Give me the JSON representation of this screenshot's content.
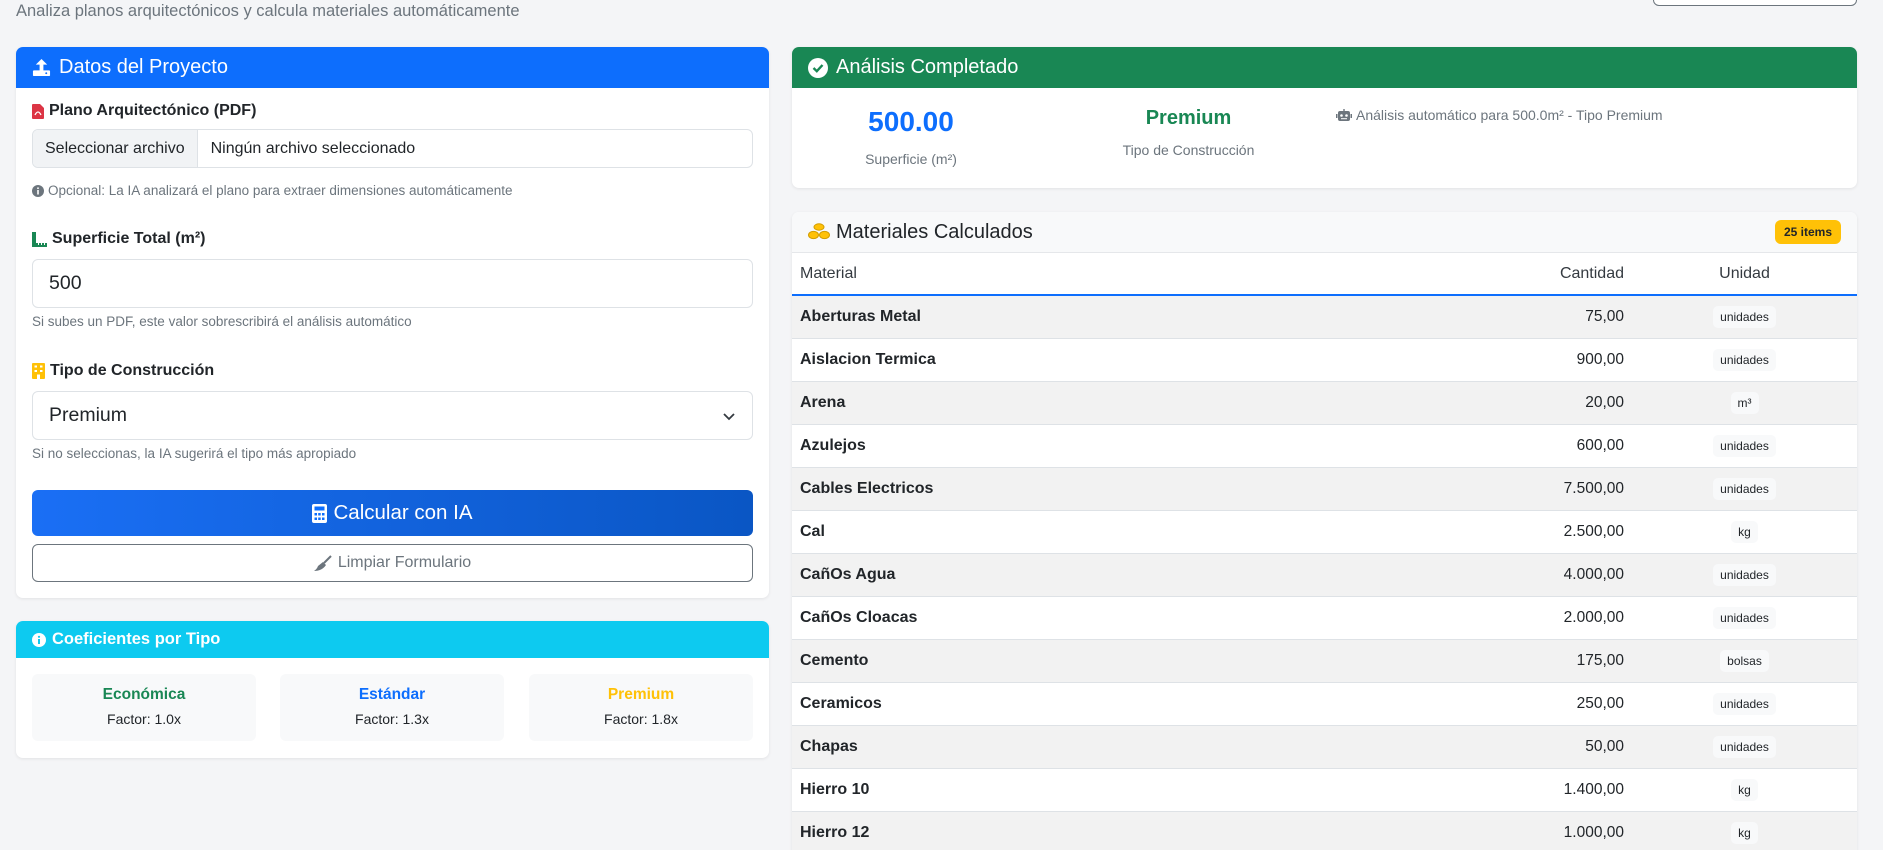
{
  "header": {
    "subtitle": "Analiza planos arquitectónicos y calcula materiales automáticamente"
  },
  "form": {
    "title": "Datos del Proyecto",
    "pdf_label": "Plano Arquitectónico (PDF)",
    "file_button": "Seleccionar archivo",
    "file_status": "Ningún archivo seleccionado",
    "pdf_help": "Opcional: La IA analizará el plano para extraer dimensiones automáticamente",
    "area_label": "Superficie Total (m²)",
    "area_value": "500",
    "area_help": "Si subes un PDF, este valor sobrescribirá el análisis automático",
    "type_label": "Tipo de Construcción",
    "type_value": "Premium",
    "type_help": "Si no seleccionas, la IA sugerirá el tipo más apropiado",
    "calc_button": "Calcular con IA",
    "clear_button": "Limpiar Formulario"
  },
  "coefficients": {
    "title": "Coeficientes por Tipo",
    "items": [
      {
        "name": "Económica",
        "factor": "Factor: 1.0x",
        "color": "#198754"
      },
      {
        "name": "Estándar",
        "factor": "Factor: 1.3x",
        "color": "#0d6efd"
      },
      {
        "name": "Premium",
        "factor": "Factor: 1.8x",
        "color": "#ffc107"
      }
    ]
  },
  "analysis": {
    "title": "Análisis Completado",
    "surface_value": "500.00",
    "surface_label": "Superficie (m²)",
    "type_value": "Premium",
    "type_label": "Tipo de Construcción",
    "note": "Análisis automático para 500.0m² - Tipo Premium"
  },
  "materials": {
    "title": "Materiales Calculados",
    "badge": "25 items",
    "columns": [
      "Material",
      "Cantidad",
      "Unidad"
    ],
    "rows": [
      {
        "material": "Aberturas Metal",
        "cantidad": "75,00",
        "unidad": "unidades"
      },
      {
        "material": "Aislacion Termica",
        "cantidad": "900,00",
        "unidad": "unidades"
      },
      {
        "material": "Arena",
        "cantidad": "20,00",
        "unidad": "m³"
      },
      {
        "material": "Azulejos",
        "cantidad": "600,00",
        "unidad": "unidades"
      },
      {
        "material": "Cables Electricos",
        "cantidad": "7.500,00",
        "unidad": "unidades"
      },
      {
        "material": "Cal",
        "cantidad": "2.500,00",
        "unidad": "kg"
      },
      {
        "material": "CañOs Agua",
        "cantidad": "4.000,00",
        "unidad": "unidades"
      },
      {
        "material": "CañOs Cloacas",
        "cantidad": "2.000,00",
        "unidad": "unidades"
      },
      {
        "material": "Cemento",
        "cantidad": "175,00",
        "unidad": "bolsas"
      },
      {
        "material": "Ceramicos",
        "cantidad": "250,00",
        "unidad": "unidades"
      },
      {
        "material": "Chapas",
        "cantidad": "50,00",
        "unidad": "unidades"
      },
      {
        "material": "Hierro 10",
        "cantidad": "1.400,00",
        "unidad": "kg"
      },
      {
        "material": "Hierro 12",
        "cantidad": "1.000,00",
        "unidad": "kg"
      }
    ]
  },
  "colors": {
    "primary": "#0d6efd",
    "success": "#198754",
    "info": "#0dcaf0",
    "warning": "#ffc107"
  },
  "icons": {
    "form_header": "upload-icon",
    "pdf": "file-pdf-icon",
    "area": "ruler-icon",
    "type": "building-icon",
    "calc": "calculator-icon",
    "clear": "broom-icon",
    "info": "info-circle-icon",
    "analysis": "check-circle-icon",
    "note": "robot-icon",
    "materials": "coins-icon"
  }
}
